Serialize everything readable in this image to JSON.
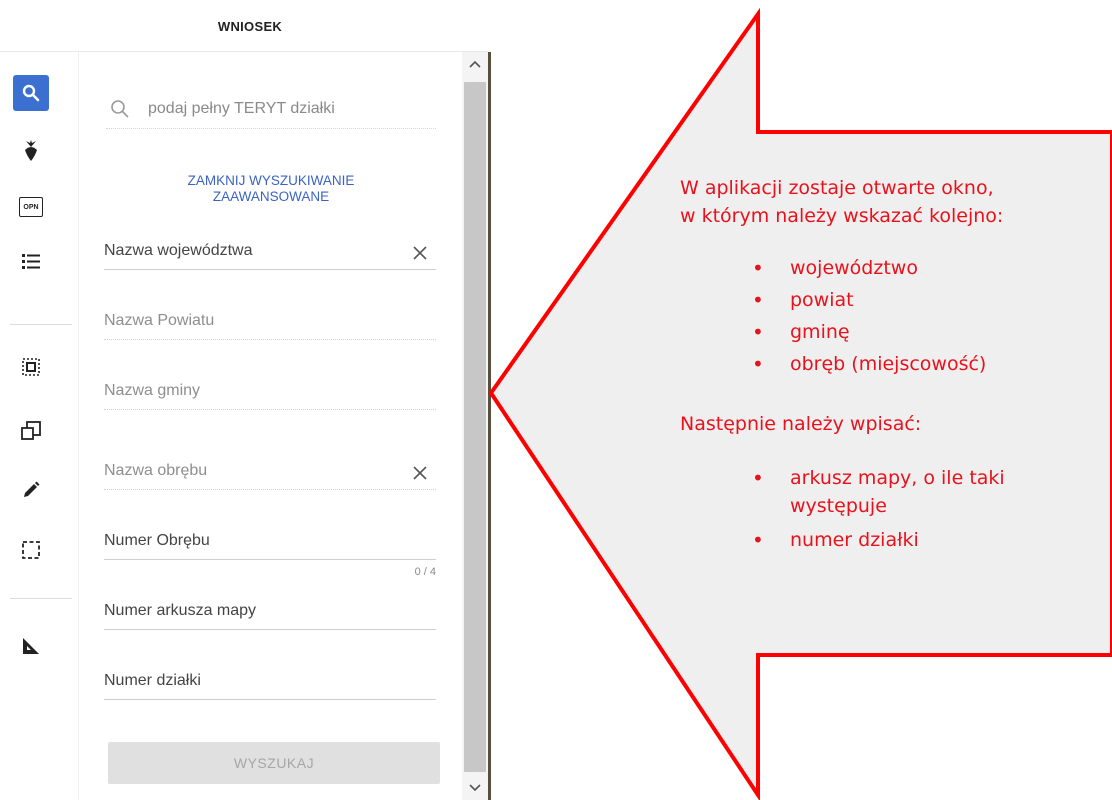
{
  "header": {
    "title": "WNIOSEK"
  },
  "toolbar": {
    "icons": [
      "search-icon",
      "beetroot-icon",
      "opn-icon",
      "list-icon",
      "select-area-icon",
      "copy-icon",
      "pencil-icon",
      "bounding-box-icon",
      "ruler-icon"
    ],
    "opn_label": "OPN",
    "active_color": "#3b6fd0"
  },
  "search": {
    "placeholder": "podaj pełny TERYT działki"
  },
  "advanced_link": {
    "line1": "ZAMKNIJ WYSZUKIWANIE",
    "line2": "ZAAWANSOWANE"
  },
  "fields": {
    "wojewodztwo": "Nazwa województwa",
    "powiat": "Nazwa Powiatu",
    "gmina": "Nazwa gminy",
    "obreb_nazwa": "Nazwa obrębu",
    "obreb_numer": "Numer Obrębu",
    "obreb_counter": "0 / 4",
    "arkusz": "Numer arkusza mapy",
    "dzialka": "Numer działki"
  },
  "search_button": "WYSZUKAJ",
  "callout": {
    "line1": "W aplikacji zostaje otwarte okno,",
    "line2": "w którym należy wskazać kolejno:",
    "items": [
      "województwo",
      "powiat",
      "gminę",
      "obręb (miejscowość)"
    ],
    "line3": "Następnie należy wpisać:",
    "items2_line1": "arkusz mapy, o ile taki",
    "items2_line2": "występuje",
    "items2_last": "numer działki",
    "text_color": "#e8121c",
    "border_color": "#ff0000",
    "fill_color": "#efefef"
  }
}
